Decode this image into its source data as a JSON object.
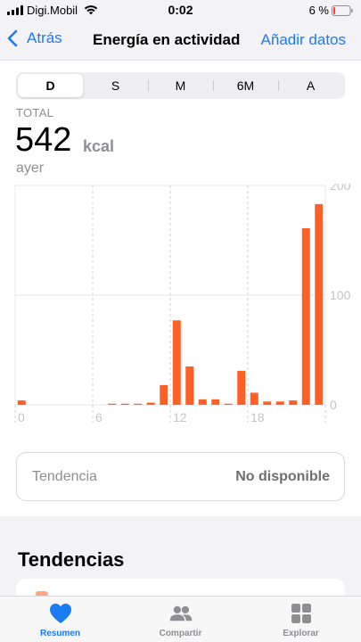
{
  "status_bar": {
    "carrier": "Digi.Mobil",
    "time": "0:02",
    "battery": "6 %"
  },
  "nav": {
    "back_label": "Atrás",
    "title": "Energía en actividad",
    "action_label": "Añadir datos"
  },
  "segments": [
    "D",
    "S",
    "M",
    "6M",
    "A"
  ],
  "selected_segment": "D",
  "summary": {
    "total_label": "TOTAL",
    "value": "542",
    "unit": "kcal",
    "date": "ayer"
  },
  "chart_data": {
    "type": "bar",
    "x_ticks": [
      "0",
      "6",
      "12",
      "18"
    ],
    "y_ticks": [
      "200",
      "100",
      "0"
    ],
    "ylim": [
      0,
      200
    ],
    "xlim": [
      0,
      24
    ],
    "bar_color": "#fd5f24",
    "hours": [
      0,
      1,
      2,
      3,
      4,
      5,
      6,
      7,
      8,
      9,
      10,
      11,
      12,
      13,
      14,
      15,
      16,
      17,
      18,
      19,
      20,
      21,
      22,
      23
    ],
    "values": [
      4,
      0,
      0,
      0,
      0,
      0,
      0,
      1,
      1,
      1,
      2,
      18,
      77,
      35,
      5,
      5,
      1,
      31,
      11,
      3,
      3,
      4,
      161,
      183
    ]
  },
  "trend": {
    "label": "Tendencia",
    "value": "No disponible"
  },
  "section_title": "Tendencias",
  "tabs": [
    {
      "label": "Resumen",
      "icon": "heart-icon",
      "active": true
    },
    {
      "label": "Compartir",
      "icon": "people-icon",
      "active": false
    },
    {
      "label": "Explorar",
      "icon": "grid-icon",
      "active": false
    }
  ],
  "colors": {
    "accent": "#1a7bf2",
    "bar": "#fd5f24"
  }
}
